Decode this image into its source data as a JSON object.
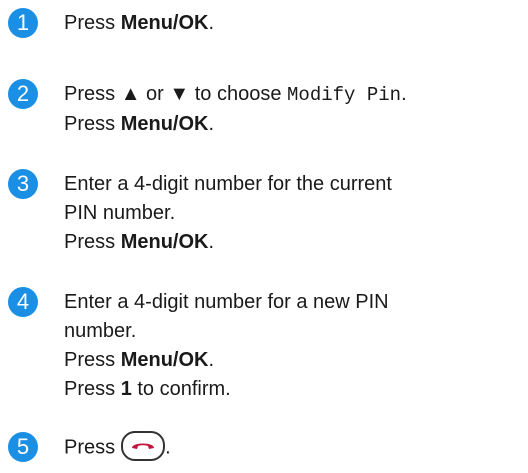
{
  "accent": "#1a8fe3",
  "handset_color": "#c0143c",
  "steps": [
    {
      "num": "1",
      "lines": [
        [
          "Press ",
          "Menu/OK",
          "."
        ]
      ]
    },
    {
      "num": "2",
      "line1": {
        "pre": "Press ",
        "up": "▲",
        "mid": " or ",
        "down": "▼",
        "post": " to choose ",
        "code": "Modify Pin",
        "end": "."
      },
      "line2": {
        "pre": "Press ",
        "bold": "Menu/OK",
        "end": "."
      }
    },
    {
      "num": "3",
      "line1": "Enter a 4-digit number for the current",
      "line2": "PIN number.",
      "line3": {
        "pre": "Press ",
        "bold": "Menu/OK",
        "end": "."
      }
    },
    {
      "num": "4",
      "line1": "Enter a 4-digit number for a new PIN",
      "line2": "number.",
      "line3": {
        "pre": "Press ",
        "bold": "Menu/OK",
        "end": "."
      },
      "line4": {
        "pre": "Press ",
        "bold": "1",
        "end": " to confirm."
      }
    },
    {
      "num": "5",
      "pre": "Press",
      "end": ".",
      "icon": "end-call-button-icon"
    }
  ]
}
